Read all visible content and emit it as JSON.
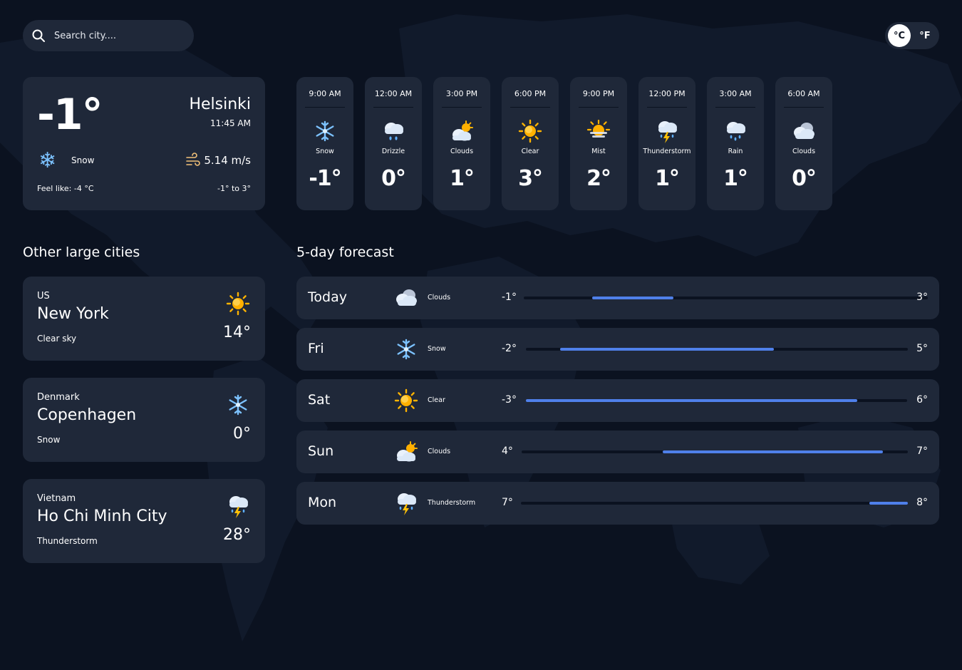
{
  "search": {
    "placeholder": "Search city...."
  },
  "units": {
    "celsius": "°C",
    "fahrenheit": "°F",
    "selected": "celsius"
  },
  "current": {
    "temp": "-1°",
    "city": "Helsinki",
    "time": "11:45 AM",
    "icon": "snowflake-icon",
    "description": "Snow",
    "wind": "5.14 m/s",
    "feels_like": "Feel like:  -4 °C",
    "range": "-1° to  3°"
  },
  "hourly": [
    {
      "time": "9:00 AM",
      "icon": "snow",
      "desc": "Snow",
      "temp": "-1°"
    },
    {
      "time": "12:00 AM",
      "icon": "drizzle",
      "desc": "Drizzle",
      "temp": "0°"
    },
    {
      "time": "3:00 PM",
      "icon": "partly-cloudy",
      "desc": "Clouds",
      "temp": "1°"
    },
    {
      "time": "6:00 PM",
      "icon": "sun",
      "desc": "Clear",
      "temp": "3°"
    },
    {
      "time": "9:00 PM",
      "icon": "mist",
      "desc": "Mist",
      "temp": "2°"
    },
    {
      "time": "12:00 PM",
      "icon": "thunder",
      "desc": "Thunderstorm",
      "temp": "1°"
    },
    {
      "time": "3:00 AM",
      "icon": "rain",
      "desc": "Rain",
      "temp": "1°"
    },
    {
      "time": "6:00 AM",
      "icon": "clouds",
      "desc": "Clouds",
      "temp": "0°"
    }
  ],
  "cities_title": "Other large cities",
  "cities": [
    {
      "country": "US",
      "name": "New York",
      "desc": "Clear sky",
      "temp": "14°",
      "icon": "sun"
    },
    {
      "country": "Denmark",
      "name": "Copenhagen",
      "desc": "Snow",
      "temp": "0°",
      "icon": "snow"
    },
    {
      "country": "Vietnam",
      "name": "Ho Chi Minh City",
      "desc": "Thunderstorm",
      "temp": "28°",
      "icon": "thunder"
    }
  ],
  "forecast_title": "5-day forecast",
  "forecast": [
    {
      "day": "Today",
      "icon": "clouds",
      "desc": "Clouds",
      "min": "-1°",
      "max": "3°",
      "range_min": -1,
      "range_max": 3,
      "fill_start": 0.17,
      "fill_end": 0.37
    },
    {
      "day": "Fri",
      "icon": "snow",
      "desc": "Snow",
      "min": "-2°",
      "max": "5°",
      "range_min": -2,
      "range_max": 5,
      "fill_start": 0.09,
      "fill_end": 0.65
    },
    {
      "day": "Sat",
      "icon": "sun",
      "desc": "Clear",
      "min": "-3°",
      "max": "6°",
      "range_min": -3,
      "range_max": 6,
      "fill_start": 0.0,
      "fill_end": 0.87
    },
    {
      "day": "Sun",
      "icon": "partly-cloudy",
      "desc": "Clouds",
      "min": "4°",
      "max": "7°",
      "range_min": 4,
      "range_max": 7,
      "fill_start": 0.365,
      "fill_end": 0.935
    },
    {
      "day": "Mon",
      "icon": "thunder",
      "desc": "Thunderstorm",
      "min": "7°",
      "max": "8°",
      "range_min": 7,
      "range_max": 8,
      "fill_start": 0.9,
      "fill_end": 1.0
    }
  ],
  "colors": {
    "background": "#0b1220",
    "card": "#1f2839",
    "accent": "#4f80ea"
  }
}
